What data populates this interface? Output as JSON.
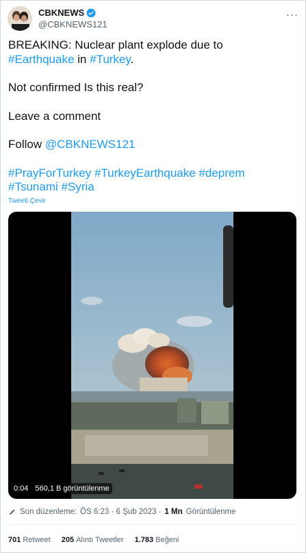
{
  "author": {
    "display_name": "CBKNEWS",
    "handle": "@CBKNEWS121",
    "avatar_icon": "avatar-photo",
    "verified_icon": "verified-badge-icon",
    "verified_color": "#1d9bf0"
  },
  "more_menu": {
    "icon": "more-options-icon",
    "label": "···"
  },
  "tweet": {
    "line1_prefix": "BREAKING: Nuclear plant explode due to",
    "hashtag_earthquake": "#Earthquake",
    "word_in": "in",
    "hashtag_turkey": "#Turkey",
    "period": ".",
    "para2": "Not confirmed Is this real?",
    "para3": "Leave a comment",
    "follow_word": "Follow",
    "mention": "@CBKNEWS121",
    "hashtags_line1": [
      "#PrayForTurkey",
      "#TurkeyEarthquake",
      "#deprem"
    ],
    "hashtags_line2": [
      "#Tsunami",
      "#Syria"
    ]
  },
  "translate_label": "Tweeti Çevir",
  "video": {
    "time": "0:04",
    "views": "560,1 B görüntülenme"
  },
  "edited": {
    "icon": "pencil-icon",
    "label": "Son düzenleme:",
    "timestamp": "ÖS 6:23 · 6 Şub 2023 ·",
    "view_count": "1 Mn",
    "view_label": "Görüntülenme"
  },
  "stats": {
    "retweets_count": "701",
    "retweets_label": "Retweet",
    "quotes_count": "205",
    "quotes_label": "Alıntı Tweetler",
    "likes_count": "1.783",
    "likes_label": "Beğeni"
  },
  "colors": {
    "link": "#1d9bf0",
    "text": "#0f1419",
    "secondary": "#536471"
  }
}
